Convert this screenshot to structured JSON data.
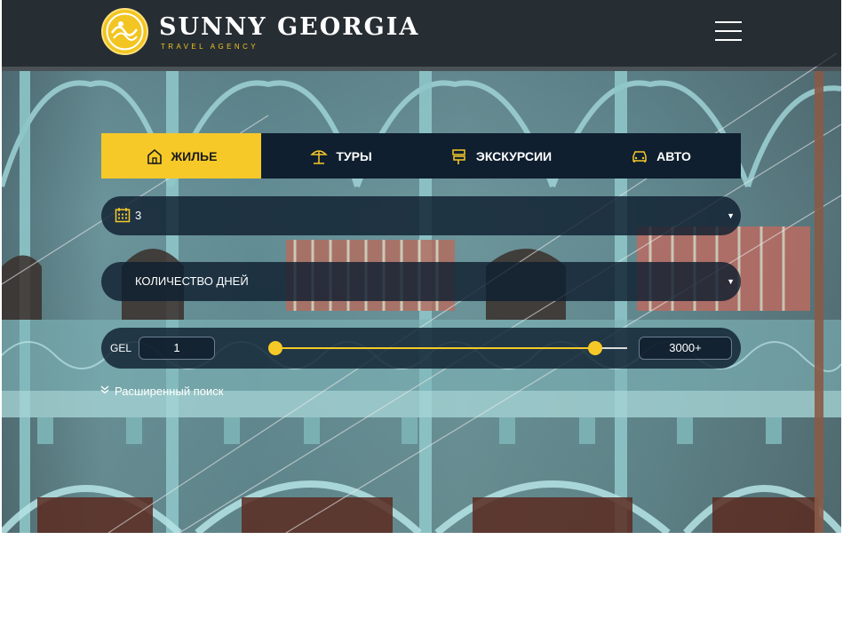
{
  "brand": {
    "title": "SUNNY GEORGIA",
    "subtitle": "TRAVEL AGENCY",
    "mark_icon": "sun-emblem-icon"
  },
  "header": {
    "menu_icon": "hamburger-menu-icon"
  },
  "tabs": [
    {
      "label": "ЖИЛЬЕ",
      "icon": "house-icon",
      "active": true
    },
    {
      "label": "ТУРЫ",
      "icon": "beach-umbrella-icon",
      "active": false
    },
    {
      "label": "ЭКСКУРСИИ",
      "icon": "signpost-icon",
      "active": false
    },
    {
      "label": "АВТО",
      "icon": "car-icon",
      "active": false
    }
  ],
  "filters": {
    "guests": {
      "value": "3",
      "icon": "calendar-icon"
    },
    "days": {
      "value": "КОЛИЧЕСТВО ДНЕЙ"
    }
  },
  "price": {
    "currency": "GEL",
    "min_value": "1",
    "max_value": "3000+",
    "range_start": 0,
    "range_end": 0.91
  },
  "advanced_search": {
    "label": "Расширенный поиск",
    "icon": "chevrons-down-icon"
  },
  "colors": {
    "accent": "#f6c928",
    "tab_bar": "#0f1f2f",
    "control_bg": "#0f1e30"
  }
}
